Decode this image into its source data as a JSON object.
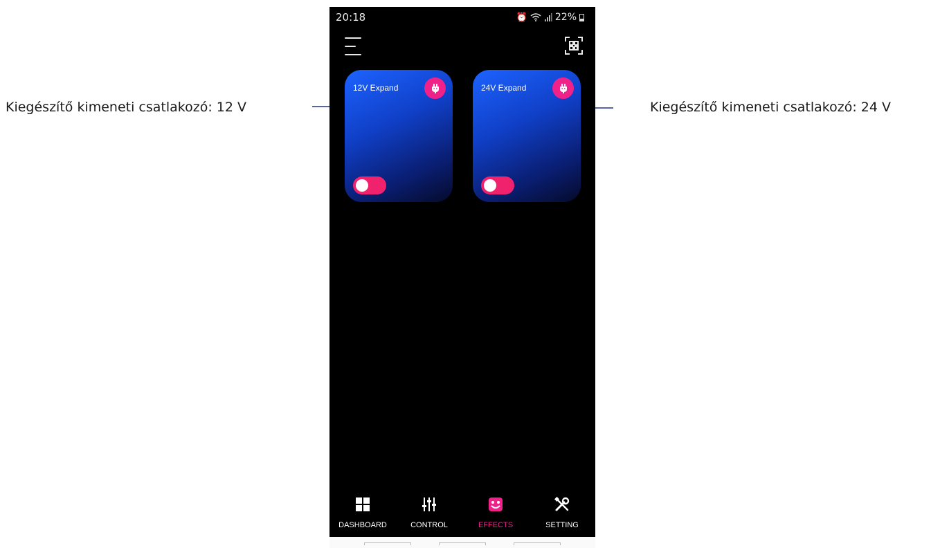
{
  "annotations": {
    "left": "Kiegészítő kimeneti csatlakozó: 12 V",
    "right": "Kiegészítő kimeneti csatlakozó: 24 V"
  },
  "status_bar": {
    "time": "20:18",
    "battery": "22%"
  },
  "cards": [
    {
      "title": "12V Expand",
      "toggle_on": true
    },
    {
      "title": "24V Expand",
      "toggle_on": true
    }
  ],
  "bottom_nav": {
    "items": [
      {
        "label": "DASHBOARD",
        "icon": "dashboard-icon",
        "active": false
      },
      {
        "label": "CONTROL",
        "icon": "sliders-icon",
        "active": false
      },
      {
        "label": "EFFECTS",
        "icon": "effects-icon",
        "active": true
      },
      {
        "label": "SETTING",
        "icon": "tools-icon",
        "active": false
      }
    ]
  },
  "colors": {
    "accent": "#f0228a",
    "toggle": "#f0226e",
    "card_top": "#1d63ff",
    "card_bottom": "#050a2a",
    "background": "#000000",
    "leader_line": "#5a62a8"
  }
}
